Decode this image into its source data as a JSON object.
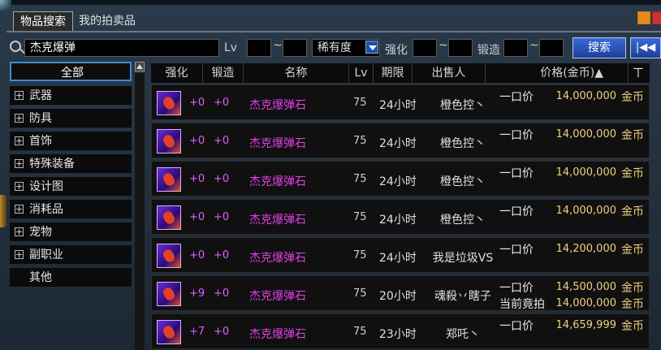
{
  "tabs": {
    "search": "物品搜索",
    "my_auctions": "我的拍卖品"
  },
  "search": {
    "keyword": "杰克爆弹",
    "lv_label": "Lv",
    "tilde": "~",
    "rarity_value": "稀有度",
    "enhance_label": "强化",
    "forge_label": "锻造",
    "search_button": "搜索",
    "back_button": "|◀◀"
  },
  "categories": [
    {
      "label": "全部",
      "expandable": false,
      "selected": true
    },
    {
      "label": "武器",
      "expandable": true
    },
    {
      "label": "防具",
      "expandable": true
    },
    {
      "label": "首饰",
      "expandable": true
    },
    {
      "label": "特殊装备",
      "expandable": true
    },
    {
      "label": "设计图",
      "expandable": true
    },
    {
      "label": "消耗品",
      "expandable": true
    },
    {
      "label": "宠物",
      "expandable": true
    },
    {
      "label": "副职业",
      "expandable": true
    },
    {
      "label": "其他",
      "expandable": false
    }
  ],
  "table": {
    "headers": {
      "enhance": "强化",
      "forge": "锻造",
      "name": "名称",
      "lv": "Lv",
      "period": "期限",
      "seller": "出售人",
      "price": "价格(金币)▲"
    },
    "rows": [
      {
        "enhance": "+0",
        "forge": "+0",
        "name": "杰克爆弹石",
        "lv": "75",
        "period": "24小时",
        "seller": "橙色控丶",
        "type": "一口价",
        "price": "14,000,000",
        "unit": "金币"
      },
      {
        "enhance": "+0",
        "forge": "+0",
        "name": "杰克爆弹石",
        "lv": "75",
        "period": "24小时",
        "seller": "橙色控丶",
        "type": "一口价",
        "price": "14,000,000",
        "unit": "金币"
      },
      {
        "enhance": "+0",
        "forge": "+0",
        "name": "杰克爆弹石",
        "lv": "75",
        "period": "24小时",
        "seller": "橙色控丶",
        "type": "一口价",
        "price": "14,000,000",
        "unit": "金币"
      },
      {
        "enhance": "+0",
        "forge": "+0",
        "name": "杰克爆弹石",
        "lv": "75",
        "period": "24小时",
        "seller": "橙色控丶",
        "type": "一口价",
        "price": "14,000,000",
        "unit": "金币"
      },
      {
        "enhance": "+0",
        "forge": "+0",
        "name": "杰克爆弹石",
        "lv": "75",
        "period": "24小时",
        "seller": "我是垃圾VS",
        "type": "一口价",
        "price": "14,200,000",
        "unit": "金币"
      },
      {
        "enhance": "+9",
        "forge": "+0",
        "name": "杰克爆弹石",
        "lv": "75",
        "period": "20小时",
        "seller": "魂殺丷瞎子",
        "type": "一口价",
        "price": "14,500,000",
        "unit": "金币",
        "type2": "当前竟拍",
        "price2": "14,000,000",
        "unit2": "金币"
      },
      {
        "enhance": "+7",
        "forge": "+0",
        "name": "杰克爆弹石",
        "lv": "75",
        "period": "23小时",
        "seller": "郑吒丶",
        "type": "一口价",
        "price": "14,659,999",
        "unit": "金币"
      }
    ]
  },
  "colors": {
    "accent": "#3c8cd8",
    "item_name": "#e040e8",
    "price": "#f0d080",
    "button": "#1c3f98"
  }
}
